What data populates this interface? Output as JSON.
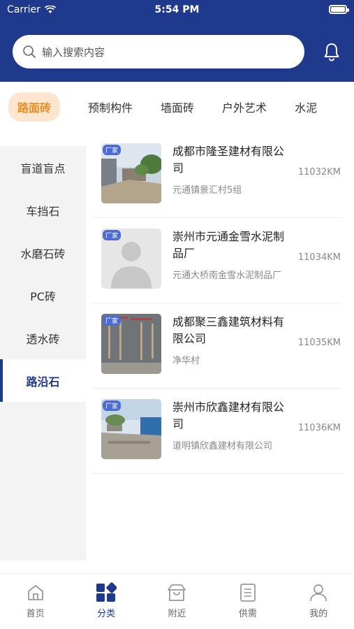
{
  "status_bar": {
    "carrier": "Carrier",
    "time": "5:54 PM",
    "battery_level": 1.0
  },
  "search": {
    "placeholder": "输入搜索内容"
  },
  "top_tabs": [
    {
      "label": "路面砖",
      "active": true
    },
    {
      "label": "预制构件",
      "active": false
    },
    {
      "label": "墙面砖",
      "active": false
    },
    {
      "label": "户外艺术",
      "active": false
    },
    {
      "label": "水泥",
      "active": false
    }
  ],
  "sidebar": {
    "items": [
      {
        "label": "盲道盲点",
        "active": false
      },
      {
        "label": "车挡石",
        "active": false
      },
      {
        "label": "水磨石砖",
        "active": false
      },
      {
        "label": "PC砖",
        "active": false
      },
      {
        "label": "透水砖",
        "active": false
      },
      {
        "label": "路沿石",
        "active": true
      }
    ]
  },
  "suppliers": [
    {
      "badge": "厂家",
      "name": "成都市隆圣建材有限公司",
      "address": "元通镇景汇村5组",
      "distance": "11032KM"
    },
    {
      "badge": "厂家",
      "name": "崇州市元通金雪水泥制品厂",
      "address": "元通大桥南金雪水泥制品厂",
      "distance": "11034KM"
    },
    {
      "badge": "厂家",
      "name": "成都聚三鑫建筑材料有限公司",
      "address": "净华村",
      "distance": "11035KM"
    },
    {
      "badge": "厂家",
      "name": "崇州市欣鑫建材有限公司",
      "address": "道明镇欣鑫建材有限公司",
      "distance": "11036KM"
    }
  ],
  "tabbar": {
    "items": [
      {
        "label": "首页",
        "icon": "home-icon",
        "active": false
      },
      {
        "label": "分类",
        "icon": "category-icon",
        "active": true
      },
      {
        "label": "附近",
        "icon": "nearby-icon",
        "active": false
      },
      {
        "label": "供需",
        "icon": "supply-demand-icon",
        "active": false
      },
      {
        "label": "我的",
        "icon": "profile-icon",
        "active": false
      }
    ]
  },
  "colors": {
    "primary": "#1f3a8c",
    "accent": "#f08a1c",
    "badge": "#4a6bd8"
  }
}
